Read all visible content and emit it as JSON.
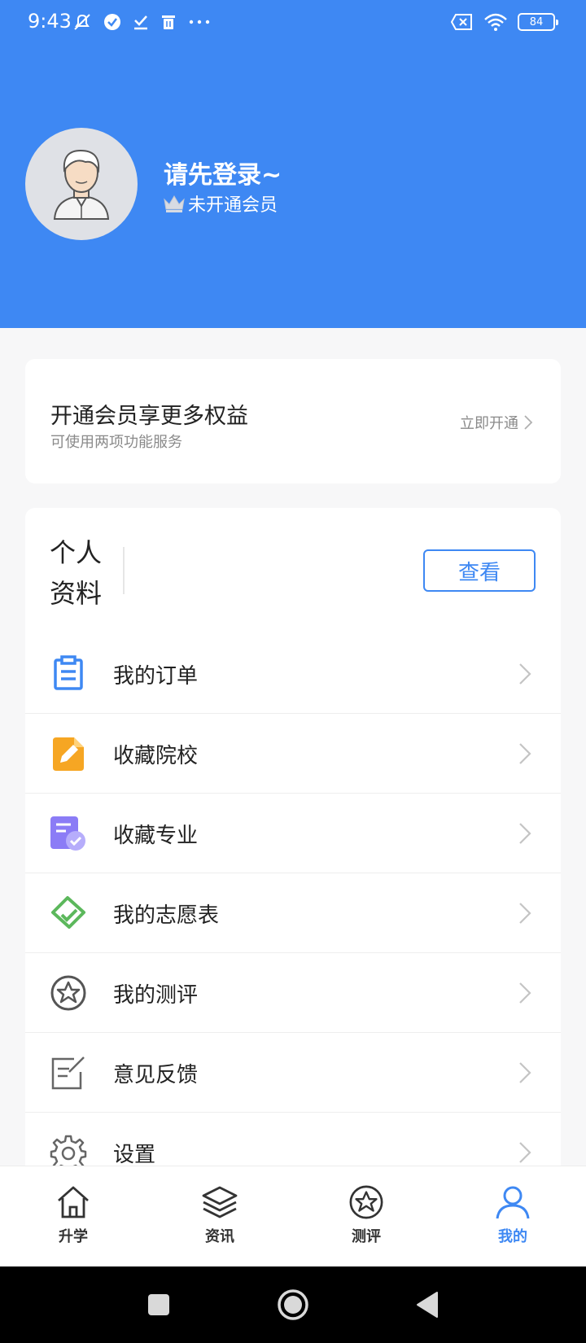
{
  "status_bar": {
    "time": "9:43",
    "battery": "84",
    "icons": [
      "mute-notification-icon",
      "check-circle-icon",
      "download-done-icon",
      "trash-icon",
      "more-dots-icon",
      "sim-x-icon",
      "wifi-icon",
      "battery-icon"
    ]
  },
  "profile_header": {
    "name": "请先登录~",
    "member_status": "未开通会员"
  },
  "vip_card": {
    "title": "开通会员享更多权益",
    "subtitle": "可使用两项功能服务",
    "action": "立即开通"
  },
  "profile_card": {
    "title": "个人资料",
    "button": "查看"
  },
  "menu": {
    "items": [
      {
        "label": "我的订单",
        "icon": "clipboard-icon"
      },
      {
        "label": "收藏院校",
        "icon": "school-edit-icon"
      },
      {
        "label": "收藏专业",
        "icon": "major-check-icon"
      },
      {
        "label": "我的志愿表",
        "icon": "volunteer-tag-icon"
      },
      {
        "label": "我的测评",
        "icon": "star-circle-icon"
      },
      {
        "label": "意见反馈",
        "icon": "feedback-edit-icon"
      },
      {
        "label": "设置",
        "icon": "gear-icon"
      }
    ]
  },
  "tabbar": {
    "tabs": [
      {
        "label": "升学",
        "icon": "home-icon"
      },
      {
        "label": "资讯",
        "icon": "layers-icon"
      },
      {
        "label": "测评",
        "icon": "star-circle-icon"
      },
      {
        "label": "我的",
        "icon": "person-icon"
      }
    ],
    "active": "我的"
  },
  "colors": {
    "brand_blue": "#3e88f3",
    "page_background": "#f7f7f8"
  }
}
